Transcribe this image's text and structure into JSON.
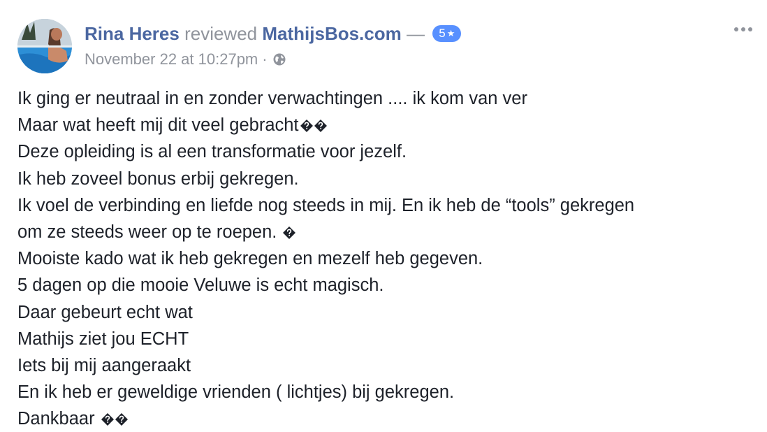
{
  "post": {
    "author": "Rina Heres",
    "action": "reviewed",
    "page": "MathijsBos.com",
    "dash": "—",
    "rating": "5",
    "rating_star": "★",
    "date": "November 22 at 10:27pm",
    "separator": "·",
    "privacy_icon": "globe-icon",
    "more_icon": "more-options-icon",
    "lines": [
      {
        "text": "Ik ging er neutraal in en zonder verwachtingen .... ik kom van ver",
        "glyphs": 0
      },
      {
        "text": "Maar wat heeft mij dit veel gebracht",
        "glyphs": 2
      },
      {
        "text": "Deze opleiding is al een transformatie voor jezelf.",
        "glyphs": 0
      },
      {
        "text": "Ik heb zoveel bonus erbij gekregen.",
        "glyphs": 0
      },
      {
        "text": "Ik voel de verbinding en liefde nog steeds in mij. En ik heb de “tools” gekregen",
        "glyphs": 0
      },
      {
        "text": "om ze steeds weer op te roepen. ",
        "glyphs": 1
      },
      {
        "text": "Mooiste kado wat ik heb gekregen en mezelf heb gegeven.",
        "glyphs": 0
      },
      {
        "text": "5 dagen op die mooie Veluwe is echt magisch.",
        "glyphs": 0
      },
      {
        "text": "Daar gebeurt echt wat",
        "glyphs": 0
      },
      {
        "text": "Mathijs ziet jou ECHT",
        "glyphs": 0
      },
      {
        "text": "Iets bij mij aangeraakt",
        "glyphs": 0
      },
      {
        "text": "En ik heb er geweldige vrienden ( lichtjes) bij gekregen.",
        "glyphs": 0
      },
      {
        "text": "Dankbaar ",
        "glyphs": 2
      }
    ]
  },
  "colors": {
    "link": "#4b67a1",
    "meta": "#90949c",
    "text": "#1d2129",
    "badge": "#5890ff"
  }
}
